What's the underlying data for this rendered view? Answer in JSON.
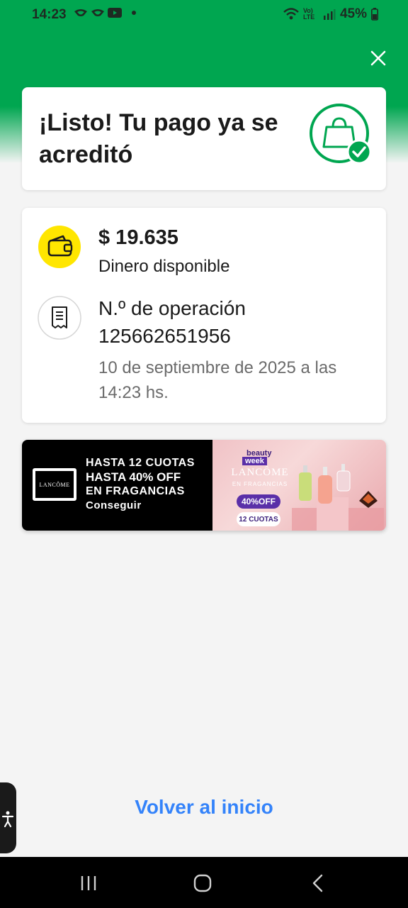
{
  "status_bar": {
    "time": "14:23",
    "network": "Vo) LTE",
    "battery": "45%"
  },
  "success": {
    "title": "¡Listo! Tu pago ya se acreditó"
  },
  "balance": {
    "amount": "$ 19.635",
    "label": "Dinero disponible"
  },
  "operation": {
    "label": "N.º de operación",
    "number": "125662651956",
    "date": "10 de septiembre de 2025 a las 14:23 hs."
  },
  "banner": {
    "logo": "LANCÔME",
    "line1": "HASTA 12 CUOTAS",
    "line2": "HASTA 40% OFF",
    "line3": "EN FRAGANCIAS",
    "cta": "Conseguir",
    "badge_top": "beauty",
    "badge_bottom": "week",
    "promo_brand": "LANCÔME",
    "promo_sub": "EN FRAGANCIAS",
    "promo_discount": "40%OFF",
    "promo_installments": "12 CUOTAS"
  },
  "footer": {
    "back_label": "Volver al inicio"
  },
  "colors": {
    "brand_green": "#00a650",
    "link_blue": "#3483fa",
    "wallet_yellow": "#ffe600"
  }
}
